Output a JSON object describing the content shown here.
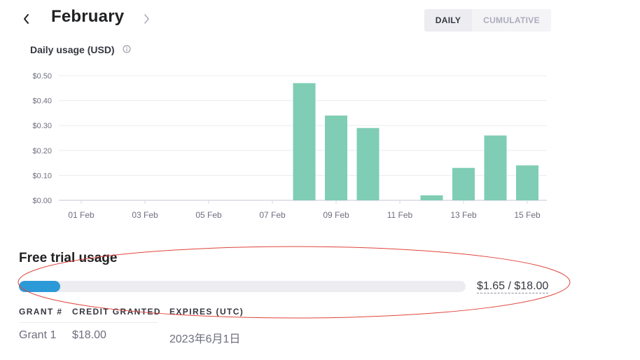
{
  "header": {
    "month": "February",
    "prev_icon": "chevron-left-icon",
    "next_icon": "chevron-right-icon",
    "toggle": {
      "daily": "DAILY",
      "cumulative": "CUMULATIVE",
      "selected": "DAILY"
    }
  },
  "chart_section": {
    "label": "Daily usage (USD)",
    "info_icon": "info-icon"
  },
  "chart_data": {
    "type": "bar",
    "title": "",
    "xlabel": "",
    "ylabel": "",
    "x": [
      "01 Feb",
      "02 Feb",
      "03 Feb",
      "04 Feb",
      "05 Feb",
      "06 Feb",
      "07 Feb",
      "08 Feb",
      "09 Feb",
      "10 Feb",
      "11 Feb",
      "12 Feb",
      "13 Feb",
      "14 Feb",
      "15 Feb"
    ],
    "values": [
      0,
      0,
      0,
      0,
      0,
      0,
      0,
      0.47,
      0.34,
      0.29,
      0,
      0.02,
      0.13,
      0.26,
      0.14
    ],
    "x_tick_labels": [
      "01 Feb",
      "03 Feb",
      "05 Feb",
      "07 Feb",
      "09 Feb",
      "11 Feb",
      "13 Feb",
      "15 Feb"
    ],
    "y_tick_labels": [
      "$0.00",
      "$0.10",
      "$0.20",
      "$0.30",
      "$0.40",
      "$0.50"
    ],
    "ylim": [
      0,
      0.5
    ],
    "grid": true,
    "bar_color": "#7fcdb4"
  },
  "free_trial": {
    "title": "Free trial usage",
    "used": 1.65,
    "total": 18.0,
    "amount_text": "$1.65 / $18.00",
    "progress_fraction": 0.0917,
    "bar_color": "#2d9ad8"
  },
  "grants": {
    "headers": [
      "GRANT #",
      "CREDIT GRANTED",
      "EXPIRES (UTC)"
    ],
    "rows": [
      {
        "grant": "Grant 1",
        "credit": "$18.00",
        "expires": "2023年6月1日"
      }
    ]
  },
  "annotation": {
    "color": "#e0433a"
  }
}
